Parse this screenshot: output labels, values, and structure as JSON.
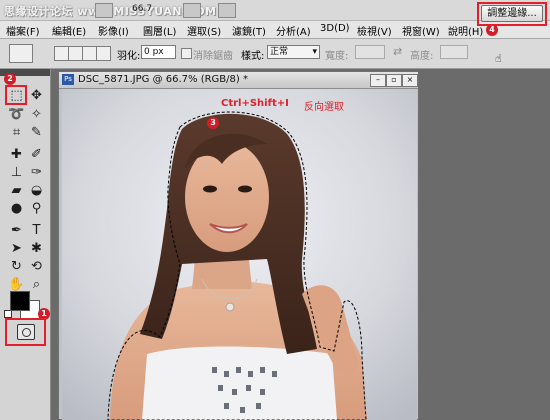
{
  "topbar": {
    "watermark": "思缘设计论坛 www.MISSYUAN.COM",
    "zoom": "66.7"
  },
  "menu": [
    "檔案(F)",
    "編輯(E)",
    "影像(I)",
    "圖層(L)",
    "選取(S)",
    "濾鏡(T)",
    "分析(A)",
    "3D(D)",
    "檢視(V)",
    "視窗(W)",
    "說明(H)"
  ],
  "options": {
    "feather_label": "羽化:",
    "feather_value": "0 px",
    "antialias_label": "消除鋸齒",
    "style_label": "樣式:",
    "style_value": "正常",
    "width_label": "寬度:",
    "height_label": "高度:",
    "refine_edge": "調整邊緣..."
  },
  "document": {
    "title": "DSC_5871.JPG @ 66.7% (RGB/8) *",
    "shortcut": "Ctrl+Shift+I",
    "shortcut_desc": "反向選取"
  },
  "badges": [
    "1",
    "2",
    "3",
    "4"
  ],
  "colors": {
    "highlight": "#e0202a",
    "foreground": "#000000",
    "background": "#ffffff"
  }
}
